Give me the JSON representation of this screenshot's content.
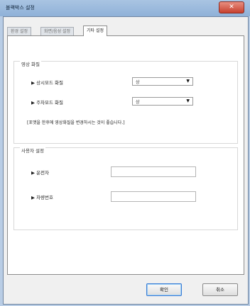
{
  "window": {
    "title": "블랙박스 설정",
    "close_glyph": "✕"
  },
  "tabs": [
    {
      "label": "환경 설정",
      "active": false
    },
    {
      "label": "화면/음성 설정",
      "active": false
    },
    {
      "label": "기타 설정",
      "active": true
    }
  ],
  "video_quality": {
    "title": "영상 화질",
    "always_mode": {
      "label": "▶ 상시모드 화질",
      "value": "상"
    },
    "parking_mode": {
      "label": "▶ 주차모드 화질",
      "value": "상"
    },
    "note": "[포맷을 한후에 영상화질을 변경하시는 것이 좋습니다.]"
  },
  "user_settings": {
    "title": "사용자 설정",
    "driver": {
      "label": "▶ 운전자",
      "value": ""
    },
    "vehicle_number": {
      "label": "▶ 차량번호",
      "value": ""
    }
  },
  "buttons": {
    "ok": "확인",
    "cancel": "취소"
  },
  "icons": {
    "dropdown": "▼",
    "close": "close-icon"
  },
  "colors": {
    "title_bar": "#8fb1d8",
    "close_button": "#c7412f",
    "default_button_border": "#3a7bd5"
  }
}
